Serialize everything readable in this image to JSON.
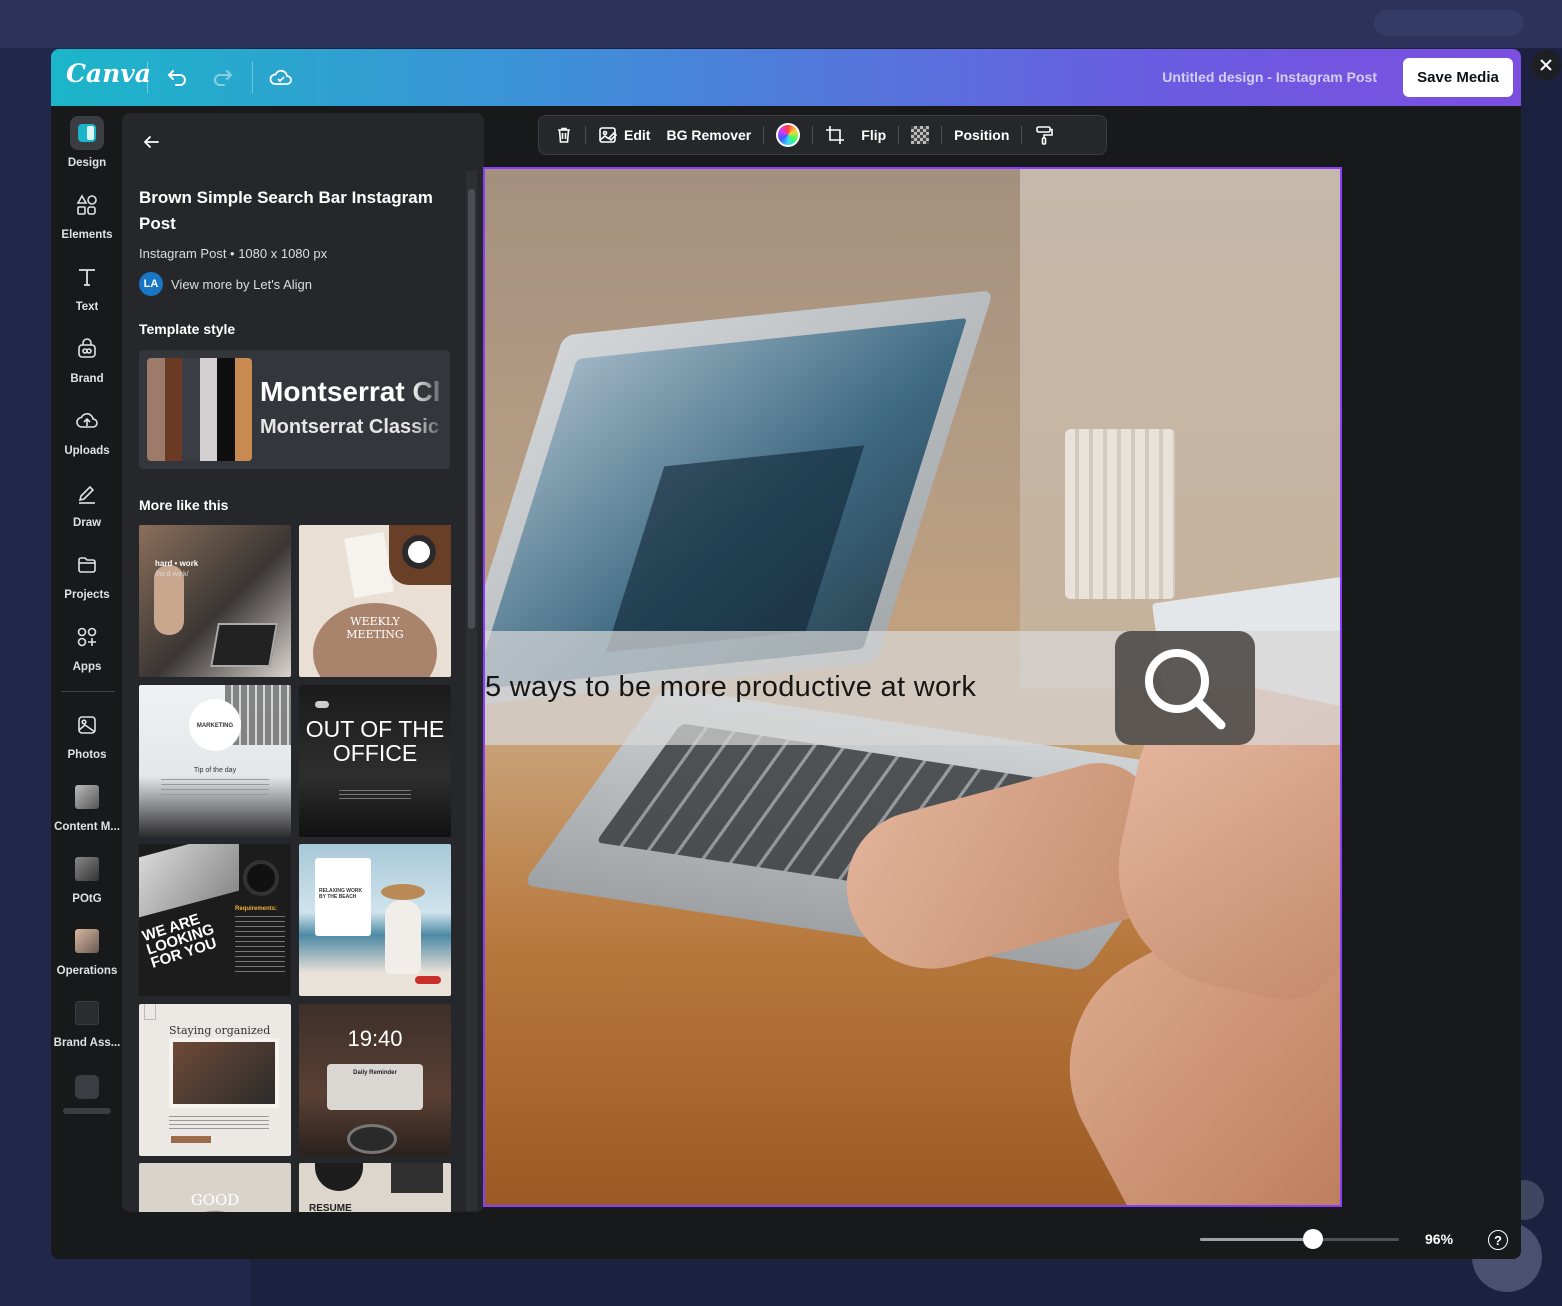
{
  "header": {
    "logo": "Canva",
    "doc_title": "Untitled design - Instagram Post",
    "save_label": "Save Media"
  },
  "rail": {
    "items": [
      {
        "label": "Design",
        "icon": "design-icon"
      },
      {
        "label": "Elements",
        "icon": "elements-icon"
      },
      {
        "label": "Text",
        "icon": "text-icon"
      },
      {
        "label": "Brand",
        "icon": "brand-icon"
      },
      {
        "label": "Uploads",
        "icon": "uploads-icon"
      },
      {
        "label": "Draw",
        "icon": "draw-icon"
      },
      {
        "label": "Projects",
        "icon": "folder-icon"
      },
      {
        "label": "Apps",
        "icon": "apps-icon"
      },
      {
        "label": "Photos",
        "icon": "photos-icon"
      },
      {
        "label": "Content M...",
        "icon": "content-thumb-icon"
      },
      {
        "label": "POtG",
        "icon": "potg-thumb-icon"
      },
      {
        "label": "Operations",
        "icon": "operations-thumb-icon"
      },
      {
        "label": "Brand Ass...",
        "icon": "brand-assets-thumb-icon"
      }
    ]
  },
  "panel": {
    "title": "Brown Simple Search Bar Instagram Post",
    "meta": "Instagram Post • 1080 x 1080 px",
    "author_initials": "LA",
    "author_link": "View more by Let's Align",
    "template_style_heading": "Template style",
    "style_font_heading": "Montserrat Cl",
    "style_font_body": "Montserrat Classic",
    "swatches": [
      "#9c7b6b",
      "#6b3a24",
      "#3a3d44",
      "#d4cfd0",
      "#0f0f0f",
      "#c98a52"
    ],
    "more_heading": "More like this",
    "tiles": [
      {
        "text": "hard • work",
        "sub": "/hɑːd·wɜːk/"
      },
      {
        "text": "WEEKLY MEETING"
      },
      {
        "text": "MARKETING",
        "sub": "Tip of the day"
      },
      {
        "text": "OUT OF THE OFFICE"
      },
      {
        "text": "WE ARE LOOKING FOR YOU",
        "sub": "Requirements:"
      },
      {
        "text": "RELAXING WORK BY THE BEACH"
      },
      {
        "text": "Staying organized"
      },
      {
        "text": "19:40",
        "sub": "Daily Reminder"
      },
      {
        "text": "GOOD"
      },
      {
        "text": "RESUME"
      }
    ]
  },
  "toolbar": {
    "edit_label": "Edit",
    "bg_remover_label": "BG Remover",
    "flip_label": "Flip",
    "position_label": "Position"
  },
  "canvas": {
    "search_text": "5 ways to be more productive at work"
  },
  "zoom": {
    "value_label": "96%",
    "level": 0.57
  },
  "help_label": "?"
}
